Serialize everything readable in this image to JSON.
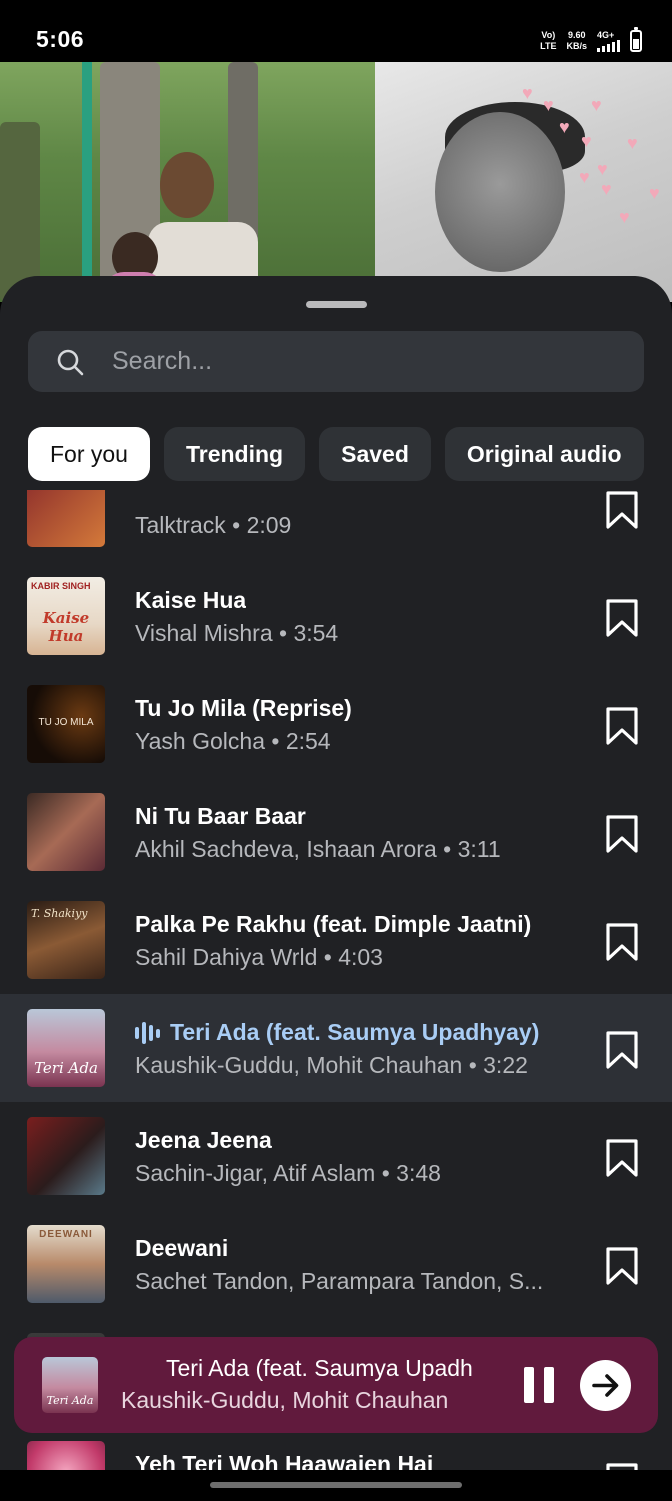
{
  "status_bar": {
    "time": "5:06",
    "network_label_top": "Vo)",
    "network_label_bottom": "LTE",
    "speed_value": "9.60",
    "speed_unit": "KB/s",
    "signal_type": "4G+"
  },
  "search": {
    "placeholder": "Search..."
  },
  "tabs": [
    {
      "label": "For you",
      "active": true
    },
    {
      "label": "Trending",
      "active": false
    },
    {
      "label": "Saved",
      "active": false
    },
    {
      "label": "Original audio",
      "active": false
    }
  ],
  "songs": [
    {
      "title": "",
      "subtitle": "Talktrack • 2:09",
      "active": false
    },
    {
      "title": "Kaise Hua",
      "subtitle": "Vishal Mishra • 3:54",
      "active": false
    },
    {
      "title": "Tu Jo Mila (Reprise)",
      "subtitle": "Yash Golcha • 2:54",
      "active": false
    },
    {
      "title": "Ni Tu Baar Baar",
      "subtitle": "Akhil Sachdeva, Ishaan Arora • 3:11",
      "active": false
    },
    {
      "title": "Palka Pe Rakhu (feat. Dimple Jaatni)",
      "subtitle": "Sahil Dahiya Wrld • 4:03",
      "active": false
    },
    {
      "title": "Teri Ada (feat. Saumya Upadhyay)",
      "subtitle": "Kaushik-Guddu, Mohit Chauhan • 3:22",
      "active": true
    },
    {
      "title": "Jeena Jeena",
      "subtitle": "Sachin-Jigar, Atif Aslam • 3:48",
      "active": false
    },
    {
      "title": "Deewani",
      "subtitle": "Sachet Tandon, Parampara Tandon, S...",
      "active": false
    },
    {
      "title": "",
      "subtitle": "",
      "active": false
    },
    {
      "title": "Yeh Teri Woh Haawaien Hai",
      "subtitle": "",
      "active": false
    }
  ],
  "thumb_text": {
    "kaise_hua": "Kaise Hua",
    "kabir_singh": "KABIR SINGH",
    "tu_jo_mila": "TU JO MILA",
    "t_shakiyy": "T. Shakiyy",
    "teri_ada": "Teri Ada",
    "deewani": "DEEWANI"
  },
  "mini_player": {
    "title": "Teri Ada (feat. Saumya Upadh",
    "artist": "Kaushik-Guddu, Mohit Chauhan",
    "thumb_text": "Teri Ada"
  },
  "colors": {
    "sheet_bg": "#202124",
    "active_row_bg": "#2d3036",
    "active_title": "#a9cdf5",
    "player_bg": "#611a3d"
  }
}
